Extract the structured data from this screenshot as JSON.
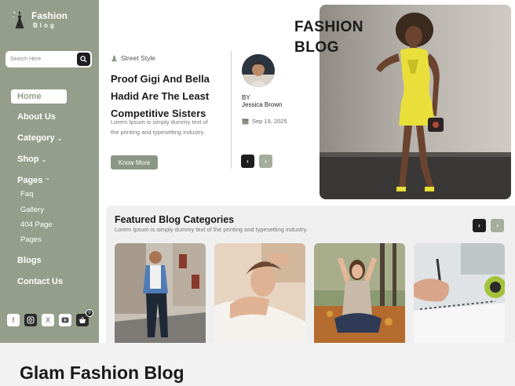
{
  "brand": {
    "line1": "Fashion",
    "line2": "Blog"
  },
  "search": {
    "placeholder": "Search Here"
  },
  "nav": {
    "home": "Home",
    "about": "About Us",
    "category": "Category",
    "shop": "Shop",
    "pages": "Pages",
    "pages_sub": [
      "Faq",
      "Gallery",
      "404 Page",
      "Pages"
    ],
    "blogs": "Blogs",
    "contact": "Contact Us"
  },
  "social": {
    "facebook": "f",
    "x": "X",
    "cart_count": "0"
  },
  "post": {
    "tag": "Street Style",
    "title": "Proof Gigi And Bella Hadid Are The Least Competitive Sisters",
    "excerpt": "Lorem Ipsum is simply dummy text of the printing and typesetting industry.",
    "cta": "Know More",
    "by": "BY",
    "author": "Jessica Brown",
    "date": "Sep 19, 2025"
  },
  "hero": {
    "line1": "FASHION",
    "line2": "BLOG"
  },
  "featured": {
    "title": "Featured Blog Categories",
    "subtitle": "Lorem Ipsum is simply dummy text of the printing and typesetting industry."
  },
  "caption": "Glam Fashion Blog",
  "colors": {
    "sidebar": "#959e8a",
    "accent": "#8c9684",
    "dark": "#1e1e1e",
    "dress": "#e8df3a"
  }
}
